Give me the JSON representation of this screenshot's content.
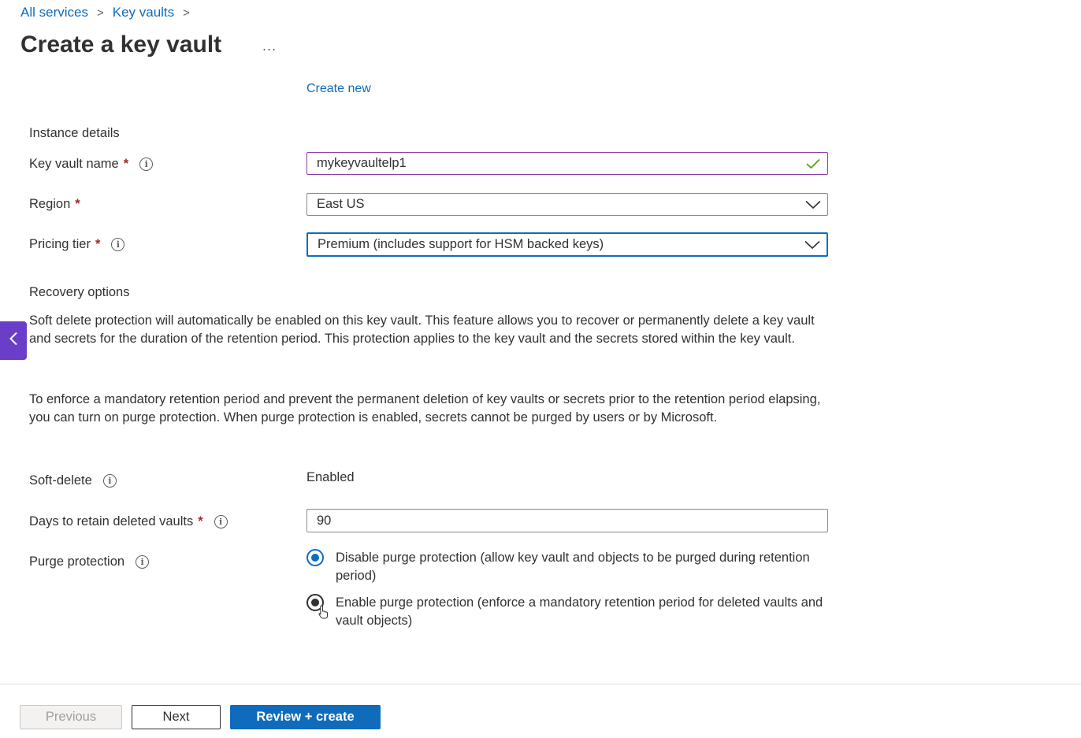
{
  "breadcrumb": {
    "items": [
      "All services",
      "Key vaults"
    ],
    "separator": ">"
  },
  "page": {
    "title": "Create a key vault",
    "more": "..."
  },
  "resource_group": {
    "create_new": "Create new"
  },
  "instance": {
    "heading": "Instance details",
    "name_label": "Key vault name",
    "name_value": "mykeyvaultelp1",
    "region_label": "Region",
    "region_value": "East US",
    "tier_label": "Pricing tier",
    "tier_value": "Premium (includes support for HSM backed keys)",
    "required_mark": "*"
  },
  "recovery": {
    "heading": "Recovery options",
    "para1": "Soft delete protection will automatically be enabled on this key vault. This feature allows you to recover or permanently delete a key vault and secrets for the duration of the retention period. This protection applies to the key vault and the secrets stored within the key vault.",
    "para2": "To enforce a mandatory retention period and prevent the permanent deletion of key vaults or secrets prior to the retention period elapsing, you can turn on purge protection. When purge protection is enabled, secrets cannot be purged by users or by Microsoft.",
    "soft_delete_label": "Soft-delete",
    "soft_delete_value": "Enabled",
    "days_label": "Days to retain deleted vaults",
    "days_value": "90",
    "purge_label": "Purge protection",
    "purge_options": [
      "Disable purge protection (allow key vault and objects to be purged during retention period)",
      "Enable purge protection (enforce a mandatory retention period for deleted vaults and vault objects)"
    ]
  },
  "footer": {
    "previous": "Previous",
    "next": "Next",
    "review": "Review + create"
  },
  "colors": {
    "accent": "#0f6cbd",
    "side_tab": "#6b3ec9",
    "required": "#a4262c",
    "valid_check": "#57a300"
  },
  "icons": [
    "chevron-right-icon",
    "info-icon",
    "checkmark-icon",
    "chevron-down-icon",
    "chevron-left-icon",
    "pointer-cursor-icon"
  ]
}
